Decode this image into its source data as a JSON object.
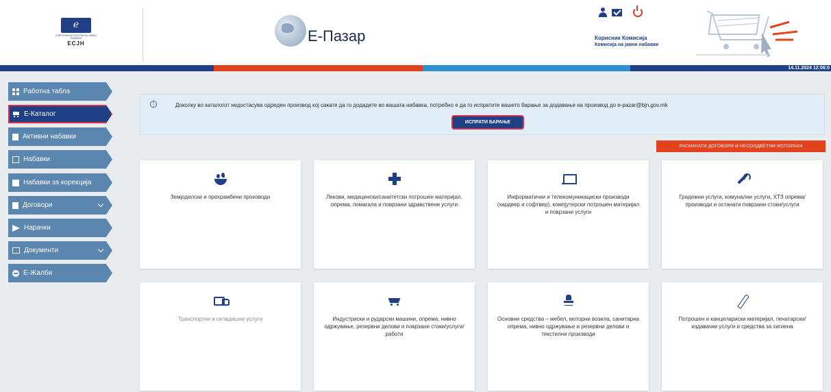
{
  "header": {
    "logo_abbr": "ЕСЈН",
    "logo_subtitle": "ЕЛЕКТРОНСКИ СИСТЕМ ЗА ЈАВНИ НАБАВКИ",
    "app_title": "Е-Пазар",
    "user_label": "Корисник Комисија",
    "user_org": "Комисија на јавни набавки",
    "datetime": "14.11.2024 12:06:0",
    "icons": [
      "user-icon",
      "mail-icon",
      "power-icon"
    ]
  },
  "colors": {
    "primary": "#1f3f86",
    "sidebar_item": "#5a86b0",
    "accent_red": "#e3421f",
    "band": [
      "#1f3f86",
      "#e3421f",
      "#2f8fcf",
      "#1f3f86"
    ]
  },
  "sidebar": {
    "items": [
      {
        "label": "Работна табла",
        "icon": "dashboard-icon"
      },
      {
        "label": "Е-Каталог",
        "icon": "cart-icon",
        "active": true
      },
      {
        "label": "Активни набавки",
        "icon": "document-icon"
      },
      {
        "label": "Набавки",
        "icon": "list-icon"
      },
      {
        "label": "Набавки за корекција",
        "icon": "edit-icon"
      },
      {
        "label": "Договори",
        "icon": "contract-icon",
        "expandable": true
      },
      {
        "label": "Нарачки",
        "icon": "send-icon"
      },
      {
        "label": "Документи",
        "icon": "folder-icon",
        "expandable": true
      },
      {
        "label": "Е-Жалби",
        "icon": "minus-circle-icon"
      }
    ]
  },
  "main": {
    "notice_text": "Доколку во каталогот недостасува одреден производ кој сакате да го додадете во вашата набавка, потребно е да го испратите вашето барање за додавање на производ до e-pazar@bjn.gov.mk",
    "send_request_label": "ИСПРАТИ БАРАЊЕ",
    "terminated_label": "РАСКИНАТИ ДОГОВОРИ И НЕСООДВЕТНИ ИСПОРАКИ",
    "categories": [
      {
        "label": "Земјоделски и прехрамбени производи",
        "icon": "food-bowl-icon"
      },
      {
        "label": "Лекови, медицински/санитетски потрошен материјал, опрема, помагала и поврзани здравствени услуги",
        "icon": "medical-plus-icon"
      },
      {
        "label": "Информатички и телекомуникациски производи (хардвер и софтвер), компјутерски потрошен материјал и поврзани услуги",
        "icon": "laptop-icon"
      },
      {
        "label": "Градежни услуги, комунални услуги, ХТЗ опрема/производи и останати поврзани стоки/услуги",
        "icon": "wrench-icon"
      },
      {
        "label": "Транспортни и складишни услуги",
        "icon": "truck-icon"
      },
      {
        "label": "Индустриски и рударски машини, опрема, нивно одржување, резервни делови и поврзани стоки/услуги/работи",
        "icon": "mine-cart-icon"
      },
      {
        "label": "Основни средства – мебел, моторни возила, санитарна опрема, нивно одржување и резервни делови и текстилни производи",
        "icon": "office-chair-icon"
      },
      {
        "label": "Потрошен и канцелариски материјал, печатарски/издавачки услуги и средства за хигиена",
        "icon": "pen-icon"
      }
    ]
  }
}
